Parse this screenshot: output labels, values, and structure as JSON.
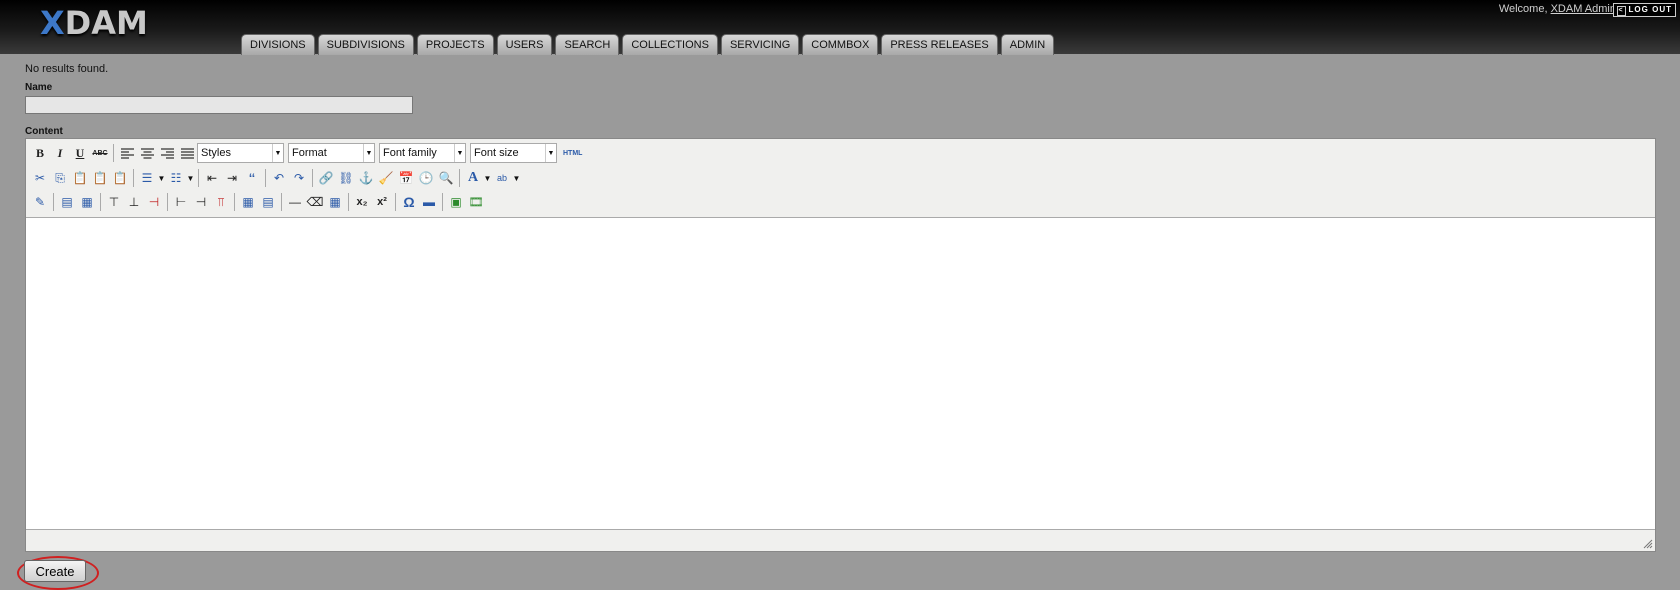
{
  "app": {
    "logo": "XDAM",
    "logo_prefix": "X",
    "logo_suffix": "DAM"
  },
  "header": {
    "welcome_text": "Welcome,",
    "username": "XDAM Admin",
    "logout_label": "LOG OUT"
  },
  "tabs": [
    {
      "label": "DIVISIONS"
    },
    {
      "label": "SUBDIVISIONS"
    },
    {
      "label": "PROJECTS"
    },
    {
      "label": "USERS"
    },
    {
      "label": "SEARCH"
    },
    {
      "label": "COLLECTIONS"
    },
    {
      "label": "SERVICING"
    },
    {
      "label": "COMMBOX"
    },
    {
      "label": "PRESS RELEASES"
    },
    {
      "label": "ADMIN"
    }
  ],
  "main": {
    "status_message": "No results found.",
    "name_label": "Name",
    "name_value": "",
    "content_label": "Content",
    "create_label": "Create"
  },
  "editor": {
    "styles_select": "Styles",
    "format_select": "Format",
    "font_family_select": "Font family",
    "font_size_select": "Font size",
    "html_label": "HTML",
    "bold_glyph": "B",
    "italic_glyph": "I",
    "underline_glyph": "U",
    "strike_glyph": "ABC",
    "subscript_glyph": "x₂",
    "superscript_glyph": "x²",
    "omega_glyph": "Ω",
    "quote_glyph": "‘‘"
  },
  "colors": {
    "page_background": "#9a9a9a",
    "logo_accent": "#3d78c8",
    "highlight_circle": "#d02020"
  }
}
